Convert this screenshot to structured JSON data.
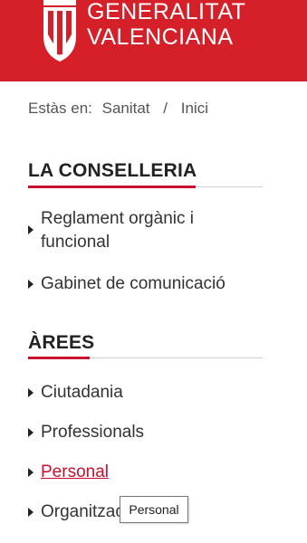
{
  "header": {
    "logo_line1": "GENERALITAT",
    "logo_line2": "VALENCIANA",
    "brand_color": "#d52029"
  },
  "breadcrumb": {
    "prefix": "Estàs en:",
    "items": [
      "Sanitat",
      "Inici"
    ],
    "separator": "/"
  },
  "conselleria": {
    "title": "LA CONSELLERIA",
    "items": [
      {
        "label": "Reglament orgànic i funcional"
      },
      {
        "label": "Gabinet de comunicació"
      }
    ]
  },
  "arees": {
    "title": "ÀREES",
    "items": [
      {
        "label": "Ciutadania"
      },
      {
        "label": "Professionals"
      },
      {
        "label": "Personal"
      },
      {
        "label": "Organització"
      }
    ]
  },
  "tooltip": {
    "text": "Personal"
  },
  "colors": {
    "accent_red": "#c8102e",
    "text": "#333333"
  }
}
